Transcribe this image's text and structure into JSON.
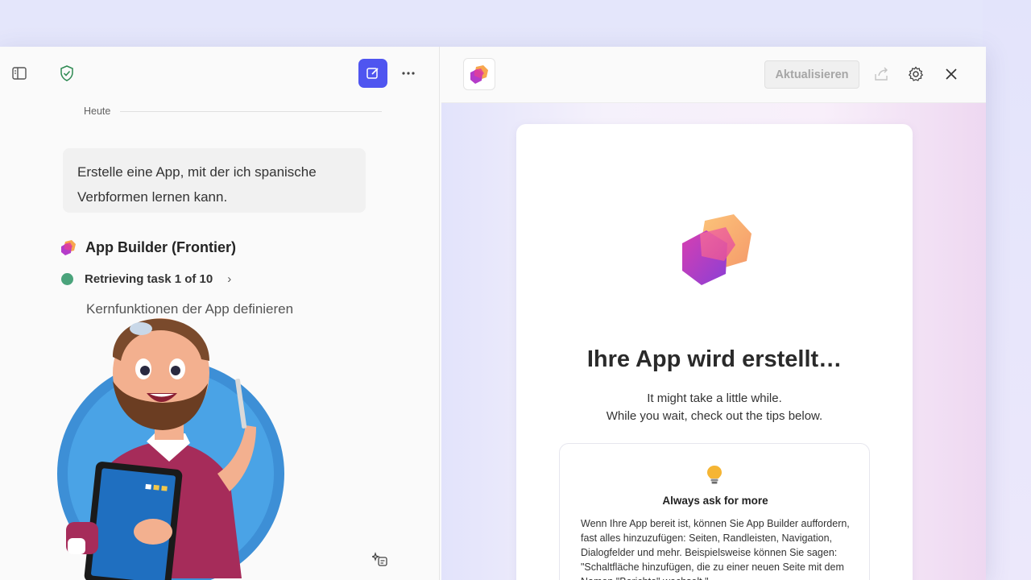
{
  "chat": {
    "date_label": "Heute",
    "user_message": "Erstelle eine App, mit der ich spanische Verbformen lernen kann.",
    "agent_name": "App Builder (Frontier)",
    "task_status": "Retrieving task 1 of 10",
    "task_description": "Kernfunktionen der App definieren"
  },
  "preview": {
    "update_button": "Aktualisieren",
    "title": "Ihre App wird erstellt…",
    "subtitle_line1": "It might take a little while.",
    "subtitle_line2": "While you wait, check out the tips below.",
    "tip": {
      "icon": "lightbulb-icon",
      "title": "Always ask for more",
      "body": "Wenn Ihre App bereit ist, können Sie App Builder auffordern, fast alles hinzuzufügen: Seiten, Randleisten, Navigation, Dialogfelder und mehr. Beispielsweise können Sie sagen: \"Schaltfläche hinzufügen, die zu einer neuen Seite mit dem Namen \"Berichte\" wechselt.\""
    }
  },
  "colors": {
    "accent": "#4f55f0",
    "status_green": "#4aa37b",
    "logo_pink": "#e0409a",
    "logo_orange": "#f7a64e",
    "logo_purple": "#8a3fd6"
  }
}
